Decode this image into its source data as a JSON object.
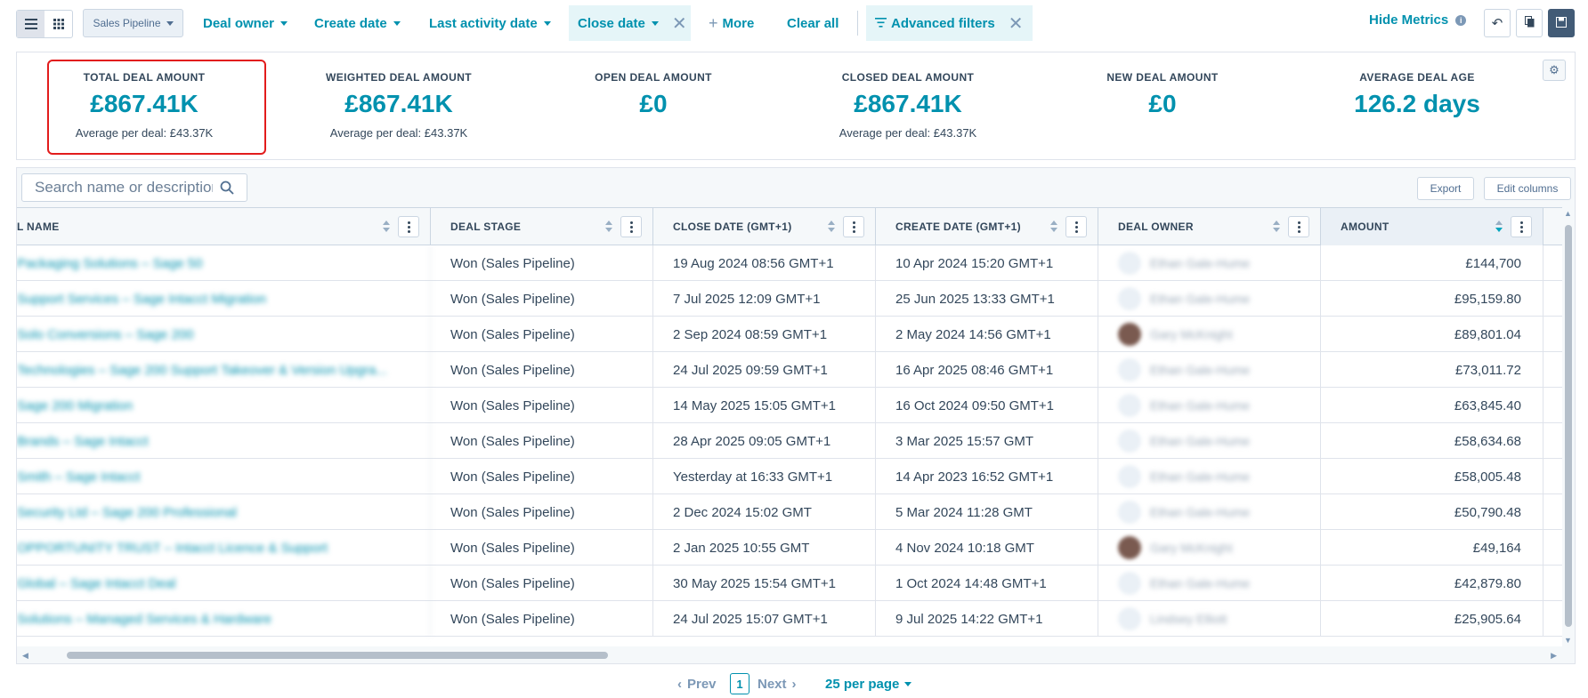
{
  "toolbar": {
    "pipeline": "Sales Pipeline",
    "filters": [
      {
        "label": "Deal owner"
      },
      {
        "label": "Create date"
      },
      {
        "label": "Last activity date"
      },
      {
        "label": "Close date"
      }
    ],
    "more": "More",
    "clear_all": "Clear all",
    "advanced_filters": "Advanced filters",
    "hide_metrics": "Hide Metrics"
  },
  "metrics": [
    {
      "label": "TOTAL DEAL AMOUNT",
      "value": "£867.41K",
      "sub": "Average per deal: £43.37K"
    },
    {
      "label": "WEIGHTED DEAL AMOUNT",
      "value": "£867.41K",
      "sub": "Average per deal: £43.37K"
    },
    {
      "label": "OPEN DEAL AMOUNT",
      "value": "£0",
      "sub": ""
    },
    {
      "label": "CLOSED DEAL AMOUNT",
      "value": "£867.41K",
      "sub": "Average per deal: £43.37K"
    },
    {
      "label": "NEW DEAL AMOUNT",
      "value": "£0",
      "sub": ""
    },
    {
      "label": "AVERAGE DEAL AGE",
      "value": "126.2 days",
      "sub": ""
    }
  ],
  "table": {
    "search_placeholder": "Search name or description",
    "export": "Export",
    "edit_columns": "Edit columns",
    "columns": [
      "L NAME",
      "DEAL STAGE",
      "CLOSE DATE (GMT+1)",
      "CREATE DATE (GMT+1)",
      "DEAL OWNER",
      "AMOUNT"
    ],
    "rows": [
      {
        "name": "Packaging Solutions – Sage 50",
        "stage": "Won (Sales Pipeline)",
        "close": "19 Aug 2024 08:56 GMT+1",
        "create": "10 Apr 2024 15:20 GMT+1",
        "owner": "Ethan Gale-Hume",
        "amount": "£144,700"
      },
      {
        "name": "Support Services – Sage Intacct Migration",
        "stage": "Won (Sales Pipeline)",
        "close": "7 Jul 2025 12:09 GMT+1",
        "create": "25 Jun 2025 13:33 GMT+1",
        "owner": "Ethan Gale-Hume",
        "amount": "£95,159.80"
      },
      {
        "name": "Solo Conversions – Sage 200",
        "stage": "Won (Sales Pipeline)",
        "close": "2 Sep 2024 08:59 GMT+1",
        "create": "2 May 2024 14:56 GMT+1",
        "owner": "Gary McKnight",
        "amount": "£89,801.04"
      },
      {
        "name": "Technologies – Sage 200 Support Takeover & Version Upgra...",
        "stage": "Won (Sales Pipeline)",
        "close": "24 Jul 2025 09:59 GMT+1",
        "create": "16 Apr 2025 08:46 GMT+1",
        "owner": "Ethan Gale-Hume",
        "amount": "£73,011.72"
      },
      {
        "name": "Sage 200 Migration",
        "stage": "Won (Sales Pipeline)",
        "close": "14 May 2025 15:05 GMT+1",
        "create": "16 Oct 2024 09:50 GMT+1",
        "owner": "Ethan Gale-Hume",
        "amount": "£63,845.40"
      },
      {
        "name": "Brands – Sage Intacct",
        "stage": "Won (Sales Pipeline)",
        "close": "28 Apr 2025 09:05 GMT+1",
        "create": "3 Mar 2025 15:57 GMT",
        "owner": "Ethan Gale-Hume",
        "amount": "£58,634.68"
      },
      {
        "name": "Smith – Sage Intacct",
        "stage": "Won (Sales Pipeline)",
        "close": "Yesterday at 16:33 GMT+1",
        "create": "14 Apr 2023 16:52 GMT+1",
        "owner": "Ethan Gale-Hume",
        "amount": "£58,005.48"
      },
      {
        "name": "Security Ltd – Sage 200 Professional",
        "stage": "Won (Sales Pipeline)",
        "close": "2 Dec 2024 15:02 GMT",
        "create": "5 Mar 2024 11:28 GMT",
        "owner": "Ethan Gale-Hume",
        "amount": "£50,790.48"
      },
      {
        "name": "OPPORTUNITY TRUST – Intacct Licence & Support",
        "stage": "Won (Sales Pipeline)",
        "close": "2 Jan 2025 10:55 GMT",
        "create": "4 Nov 2024 10:18 GMT",
        "owner": "Gary McKnight",
        "amount": "£49,164"
      },
      {
        "name": "Global – Sage Intacct Deal",
        "stage": "Won (Sales Pipeline)",
        "close": "30 May 2025 15:54 GMT+1",
        "create": "1 Oct 2024 14:48 GMT+1",
        "owner": "Ethan Gale-Hume",
        "amount": "£42,879.80"
      },
      {
        "name": "Solutions – Managed Services & Hardware",
        "stage": "Won (Sales Pipeline)",
        "close": "24 Jul 2025 15:07 GMT+1",
        "create": "9 Jul 2025 14:22 GMT+1",
        "owner": "Lindsey Elliott",
        "amount": "£25,905.64"
      }
    ]
  },
  "pagination": {
    "prev": "Prev",
    "page": "1",
    "next": "Next",
    "per_page": "25 per page"
  }
}
